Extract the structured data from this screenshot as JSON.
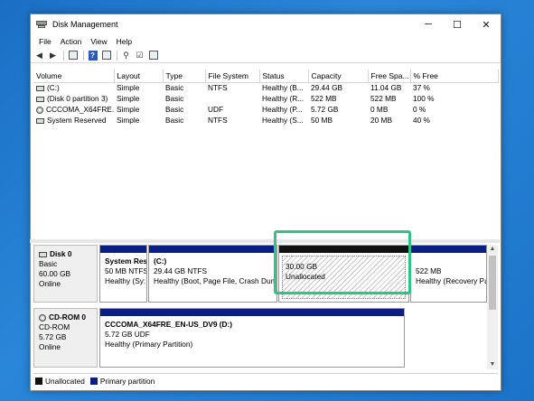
{
  "window": {
    "title": "Disk Management"
  },
  "controls": {
    "minimize": "─",
    "maximize": "☐",
    "close": "✕"
  },
  "menu": [
    "File",
    "Action",
    "View",
    "Help"
  ],
  "toolbar": [
    "back-icon",
    "forward-icon",
    "console-icon",
    "help-icon",
    "console-tree-icon",
    "search-icon",
    "check-icon",
    "properties-icon"
  ],
  "volumes": {
    "headers": [
      "Volume",
      "Layout",
      "Type",
      "File System",
      "Status",
      "Capacity",
      "Free Spa...",
      "% Free"
    ],
    "rows": [
      [
        "(C:)",
        "Simple",
        "Basic",
        "NTFS",
        "Healthy (B...",
        "29.44 GB",
        "11.04 GB",
        "37 %"
      ],
      [
        "(Disk 0 partition 3)",
        "Simple",
        "Basic",
        "",
        "Healthy (R...",
        "522 MB",
        "522 MB",
        "100 %"
      ],
      [
        "CCCOMA_X64FRE...",
        "Simple",
        "Basic",
        "UDF",
        "Healthy (P...",
        "5.72 GB",
        "0 MB",
        "0 %"
      ],
      [
        "System Reserved",
        "Simple",
        "Basic",
        "NTFS",
        "Healthy (S...",
        "50 MB",
        "20 MB",
        "40 %"
      ]
    ]
  },
  "disks": {
    "disk0": {
      "name": "Disk 0",
      "type": "Basic",
      "size": "60.00 GB",
      "status": "Online",
      "partitions": {
        "sysres": {
          "title": "System Res",
          "line2": "50 MB NTFS",
          "line3": "Healthy (Sy:"
        },
        "c": {
          "title": "(C:)",
          "line2": "29.44 GB NTFS",
          "line3": "Healthy (Boot, Page File, Crash Dum"
        },
        "unalloc": {
          "line1": "30.00 GB",
          "line2": "Unallocated"
        },
        "recovery": {
          "line1": "522 MB",
          "line2": "Healthy (Recovery Pa"
        }
      }
    },
    "cdrom0": {
      "name": "CD-ROM 0",
      "type": "CD-ROM",
      "size": "5.72 GB",
      "status": "Online",
      "partition": {
        "title": "CCCOMA_X64FRE_EN-US_DV9  (D:)",
        "line2": "5.72 GB UDF",
        "line3": "Healthy (Primary Partition)"
      }
    }
  },
  "legend": {
    "unallocated": "Unallocated",
    "primary": "Primary partition"
  },
  "colors": {
    "primary": "#0a1f86",
    "unallocated": "#111111",
    "highlight": "#2ec488"
  }
}
